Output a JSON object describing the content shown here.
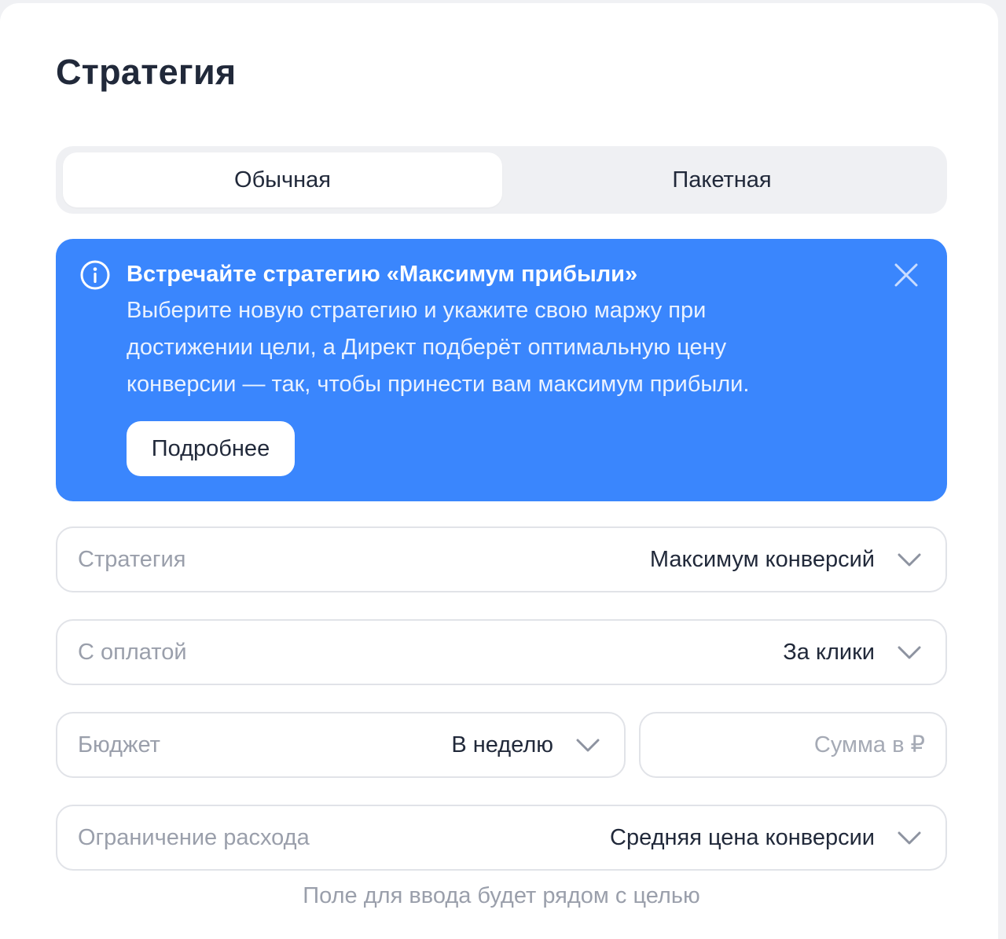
{
  "page": {
    "title": "Стратегия"
  },
  "tabs": [
    {
      "label": "Обычная",
      "active": true
    },
    {
      "label": "Пакетная",
      "active": false
    }
  ],
  "promo": {
    "title": "Встречайте стратегию «Максимум прибыли»",
    "lines": [
      "Выберите новую стратегию и укажите свою маржу при",
      "достижении цели, а Директ подберёт оптимальную цену",
      "конверсии — так, чтобы принести вам максимум прибыли."
    ],
    "button_label": "Подробнее",
    "info_icon": "info-icon",
    "close_icon": "close-icon",
    "background_color": "#3a86fd"
  },
  "fields": {
    "strategy": {
      "label": "Стратегия",
      "value": "Максимум конверсий"
    },
    "payment": {
      "label": "С оплатой",
      "value": "За клики"
    },
    "budget": {
      "label": "Бюджет",
      "value": "В неделю"
    },
    "amount": {
      "placeholder": "Сумма в ₽",
      "value": ""
    },
    "spend_limit": {
      "label": "Ограничение расхода",
      "value": "Средняя цена конверсии"
    }
  },
  "hint": "Поле для ввода будет рядом с целью"
}
